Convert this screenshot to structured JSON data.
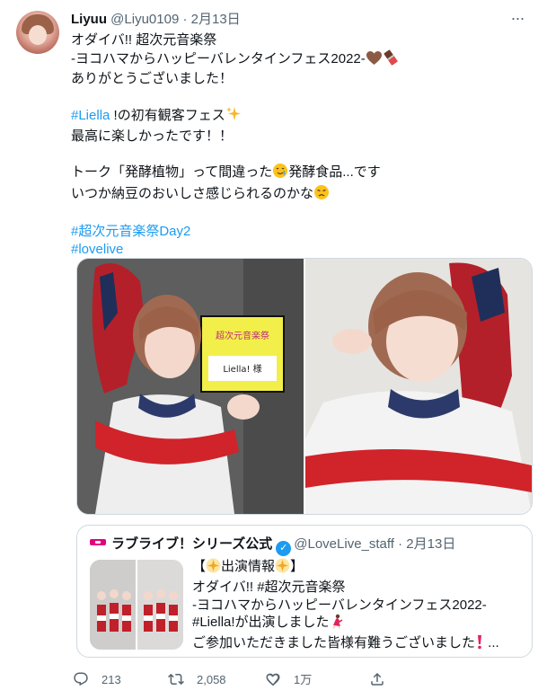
{
  "author": {
    "name": "Liyuu",
    "handle": "@Liyu0109",
    "separator": "·",
    "date": "2月13日"
  },
  "more_label": "···",
  "body": {
    "l1": "オダイバ!! 超次元音楽祭",
    "l2": "-ヨコハマからハッピーバレンタインフェス2022-",
    "l3": "ありがとうございました！",
    "l4_link": "#Liella",
    "l4_rest": " !の初有観客フェス",
    "l5": "最高に楽しかったです！！",
    "l6": "トーク「発酵植物」って間違った",
    "l6_rest": "発酵食品...です",
    "l7": "いつか納豆のおいしさ感じられるのかな",
    "l8_link": "#超次元音楽祭Day2",
    "l9_link": "#lovelive"
  },
  "photos": {
    "sign_line1": "超次元音楽祭",
    "sign_label": "Liella! 様"
  },
  "quote": {
    "name": "ラブライブ！シリーズ公式",
    "verified_mark": "✓",
    "handle": "@LoveLive_staff",
    "separator": "·",
    "date": "2月13日",
    "t1_a": "【",
    "t1_b": "出演情報",
    "t1_c": "】",
    "t2": "オダイバ!! #超次元音楽祭",
    "t3": "-ヨコハマからハッピーバレンタインフェス2022-",
    "t4": "#Liella!が出演しました",
    "t5": "ご参加いただきました皆様有難うございました",
    "t5_end": " ..."
  },
  "actions": {
    "replies": "213",
    "retweets": "2,058",
    "likes": "1万"
  },
  "colors": {
    "link": "#1d9bf0",
    "secondary_text": "#536471",
    "border": "#cfd9de",
    "brand_pink": "#e4007f"
  }
}
